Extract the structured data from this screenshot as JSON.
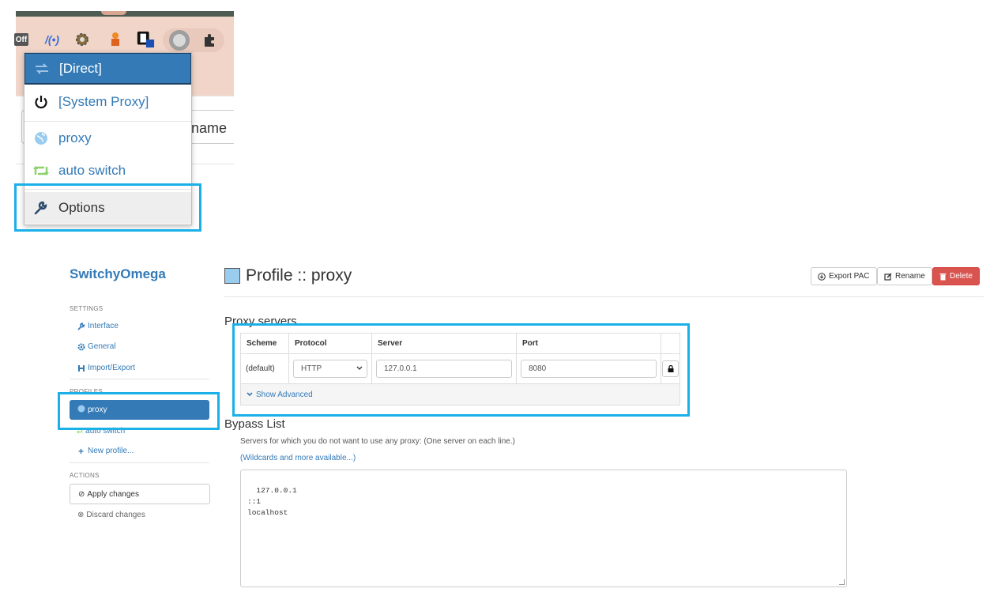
{
  "popup": {
    "ext_off_label": "Off",
    "items": [
      {
        "label": "[Direct]",
        "icon": "direct-arrows-icon"
      },
      {
        "label": "[System Proxy]",
        "icon": "power-icon"
      },
      {
        "label": "proxy",
        "icon": "globe-icon"
      },
      {
        "label": "auto switch",
        "icon": "retweet-icon"
      },
      {
        "label": "Options",
        "icon": "wrench-icon"
      }
    ],
    "partial_field_text": "name"
  },
  "sidebar": {
    "brand": "SwitchyOmega",
    "settings_heading": "SETTINGS",
    "settings_items": [
      {
        "label": "Interface",
        "icon": "wrench-icon"
      },
      {
        "label": "General",
        "icon": "gear-icon"
      },
      {
        "label": "Import/Export",
        "icon": "floppy-icon"
      }
    ],
    "profiles_heading": "PROFILES",
    "profiles": [
      {
        "label": "proxy",
        "icon": "globe-icon"
      },
      {
        "label": "auto switch",
        "icon": "retweet-icon"
      }
    ],
    "new_profile": "New profile...",
    "actions_heading": "ACTIONS",
    "apply_label": "Apply changes",
    "discard_label": "Discard changes"
  },
  "header": {
    "title": "Profile :: proxy",
    "swatch_color": "#99ccee",
    "export_label": "Export PAC",
    "rename_label": "Rename",
    "delete_label": "Delete"
  },
  "proxy_servers": {
    "title": "Proxy servers",
    "columns": [
      "Scheme",
      "Protocol",
      "Server",
      "Port"
    ],
    "row": {
      "scheme": "(default)",
      "protocol": "HTTP",
      "server": "127.0.0.1",
      "port": "8080"
    },
    "show_advanced": "Show Advanced"
  },
  "bypass": {
    "title": "Bypass List",
    "help": "Servers for which you do not want to use any proxy: (One server on each line.)",
    "link": "(Wildcards and more available...)",
    "content": "127.0.0.1\n::1\nlocalhost"
  },
  "colors": {
    "accent": "#337ab7",
    "highlight": "#1ab0e8",
    "danger": "#d9534f"
  }
}
